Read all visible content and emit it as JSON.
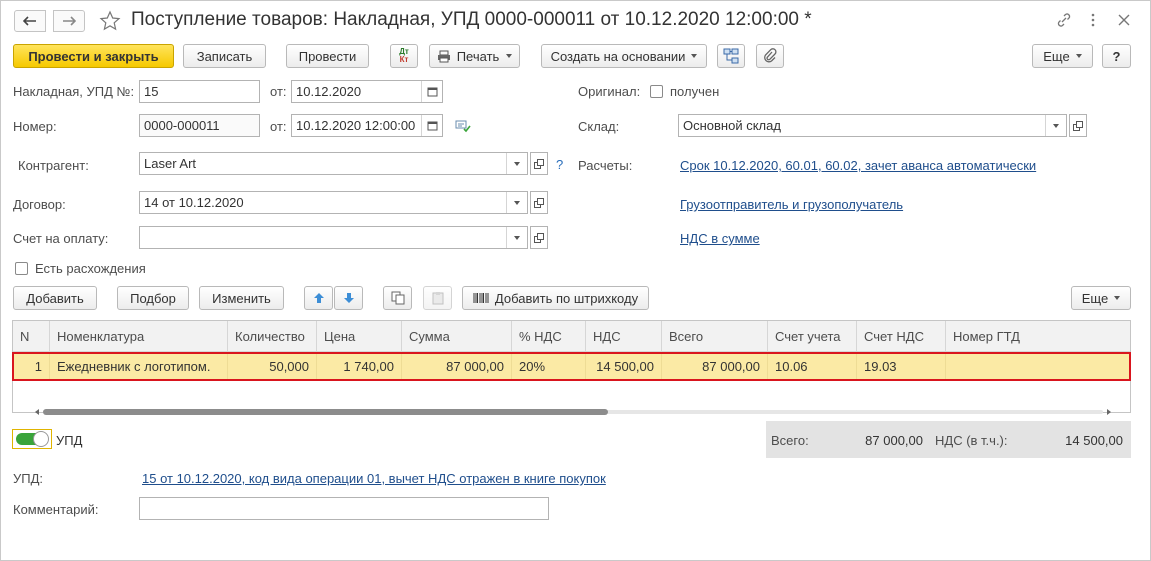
{
  "window": {
    "title": "Поступление товаров: Накладная, УПД 0000-000011 от 10.12.2020 12:00:00 *"
  },
  "toolbar": {
    "post_close": "Провести и закрыть",
    "save": "Записать",
    "post": "Провести",
    "dtkt_dt": "Дт",
    "dtkt_kt": "Кт",
    "print": "Печать",
    "create_based": "Создать на основании",
    "more": "Еще",
    "help": "?"
  },
  "form": {
    "invoice_label": "Накладная, УПД №:",
    "invoice_value": "15",
    "from_label": "от:",
    "invoice_date": "10.12.2020",
    "number_label": "Номер:",
    "number_value": "0000-000011",
    "number_date": "10.12.2020 12:00:00",
    "original_label": "Оригинал:",
    "original_check_label": "получен",
    "warehouse_label": "Склад:",
    "warehouse_value": "Основной склад",
    "counterparty_label": "Контрагент:",
    "counterparty_value": "Laser Art",
    "question": "?",
    "settlements_label": "Расчеты:",
    "settlements_link": "Срок 10.12.2020, 60.01, 60.02, зачет аванса автоматически",
    "contract_label": "Договор:",
    "contract_value": "14 от 10.12.2020",
    "shipper_link": "Грузоотправитель и грузополучатель",
    "payment_label": "Счет на оплату:",
    "payment_value": "",
    "vat_link": "НДС в сумме",
    "discrepancy_label": "Есть расхождения"
  },
  "table_toolbar": {
    "add": "Добавить",
    "pick": "Подбор",
    "edit": "Изменить",
    "barcode": "Добавить по штрихкоду",
    "more": "Еще"
  },
  "table": {
    "headers": [
      "N",
      "Номенклатура",
      "Количество",
      "Цена",
      "Сумма",
      "% НДС",
      "НДС",
      "Всего",
      "Счет учета",
      "Счет НДС",
      "Номер ГТД"
    ],
    "rows": [
      [
        "1",
        "Ежедневник с логотипом.",
        "50,000",
        "1 740,00",
        "87 000,00",
        "20%",
        "14 500,00",
        "87 000,00",
        "10.06",
        "19.03",
        ""
      ]
    ]
  },
  "footer": {
    "upd_toggle_label": "УПД",
    "upd_label": "УПД:",
    "upd_link": "15 от 10.12.2020, код вида операции 01, вычет НДС отражен в книге покупок",
    "comment_label": "Комментарий:",
    "comment_value": "",
    "total_label": "Всего:",
    "total_value": "87 000,00",
    "vat_label": "НДС (в т.ч.):",
    "vat_value": "14 500,00"
  },
  "colors": {
    "primary_button": "#f6c900",
    "link": "#1f4e8c",
    "row_highlight": "#fbeaa5",
    "highlight_border": "#d9151e",
    "toggle_on": "#3aa43a"
  }
}
